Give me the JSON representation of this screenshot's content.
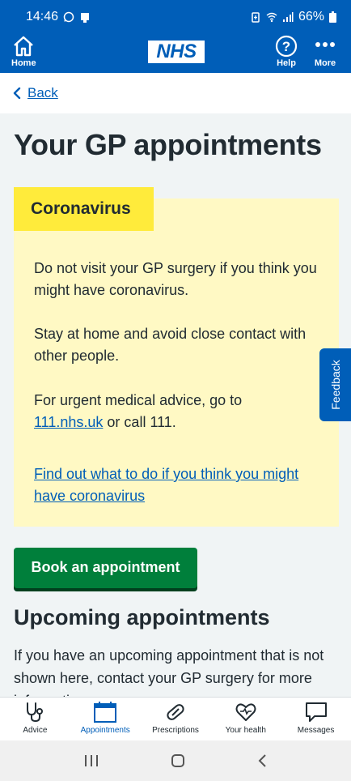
{
  "status_bar": {
    "time": "14:46",
    "battery": "66%",
    "icons": [
      "whatsapp-icon",
      "notification-icon",
      "battery-saver-icon",
      "wifi-icon",
      "signal-icon",
      "battery-icon"
    ]
  },
  "app_bar": {
    "home_label": "Home",
    "logo_text": "NHS",
    "help_label": "Help",
    "more_label": "More"
  },
  "back_label": "Back",
  "page_title": "Your GP appointments",
  "care_card": {
    "heading": "Coronavirus",
    "paragraph1": "Do not visit your GP surgery if you think you might have coronavirus.",
    "paragraph2": "Stay at home and avoid close contact with other people.",
    "paragraph3_prefix": "For urgent medical advice, go to",
    "paragraph3_link": "111.nhs.uk",
    "paragraph3_suffix": "or call 111.",
    "link_text": "Find out what to do if you think you might have coronavirus"
  },
  "feedback_label": "Feedback",
  "book_button_label": "Book an appointment",
  "upcoming_heading": "Upcoming appointments",
  "upcoming_text": "If you have an upcoming appointment that is not shown here, contact your GP surgery for more information.",
  "bottom_nav": {
    "items": [
      {
        "label": "Advice",
        "icon": "stethoscope-icon"
      },
      {
        "label": "Appointments",
        "icon": "calendar-icon"
      },
      {
        "label": "Prescriptions",
        "icon": "pill-icon"
      },
      {
        "label": "Your health",
        "icon": "heart-icon"
      },
      {
        "label": "Messages",
        "icon": "message-icon"
      }
    ],
    "active": "Appointments"
  },
  "colors": {
    "nhs_blue": "#005eb8",
    "care_card_bg": "#fff9c4",
    "care_heading_bg": "#ffeb3b",
    "button_green": "#007f3b"
  }
}
